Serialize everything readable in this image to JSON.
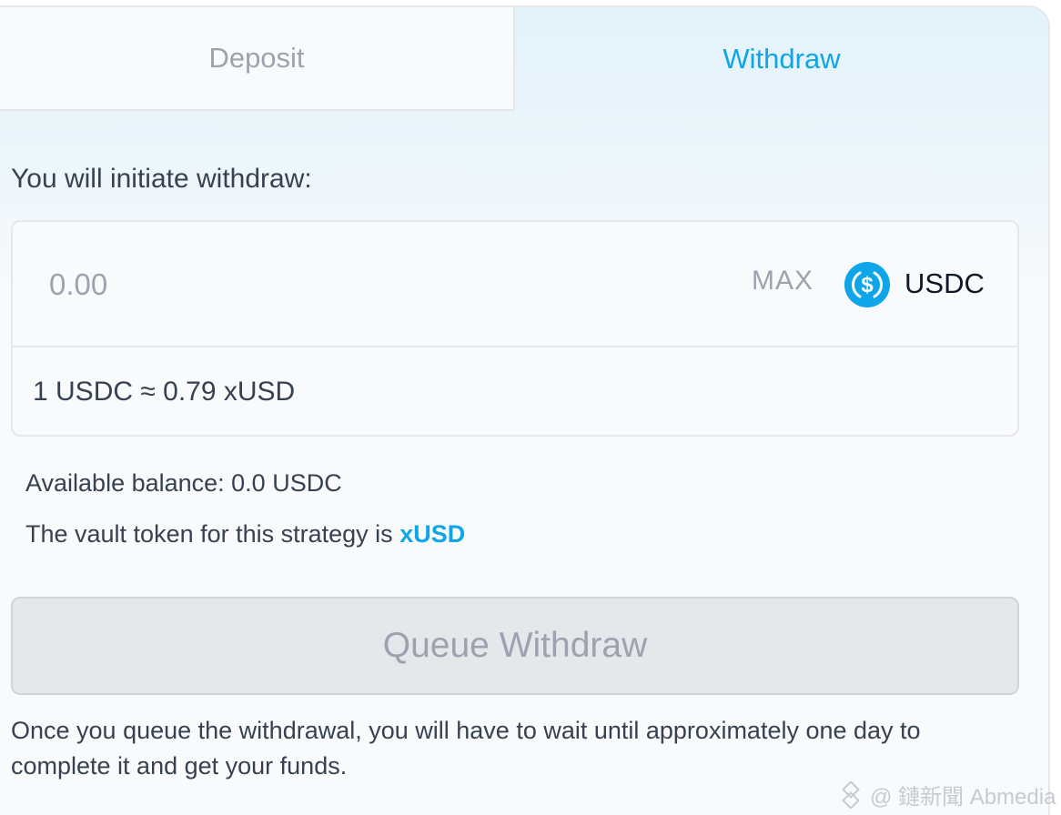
{
  "tabs": [
    {
      "label": "Deposit",
      "active": false
    },
    {
      "label": "Withdraw",
      "active": true
    }
  ],
  "form": {
    "title": "You will initiate withdraw:",
    "amount_placeholder": "0.00",
    "max_label": "MAX",
    "token": {
      "name": "USDC",
      "icon": "usdc-icon",
      "color": "#0ea5e9"
    },
    "rate": "1 USDC ≈ 0.79 xUSD"
  },
  "info": {
    "balance": "Available balance: 0.0 USDC",
    "vault_prefix": "The vault token for this strategy is ",
    "vault_token": "xUSD"
  },
  "actions": {
    "queue_label": "Queue Withdraw"
  },
  "note": "Once you queue the withdrawal, you will have to wait until approximately one day to complete it and get your funds.",
  "watermark": "@ 鏈新聞 Abmedia",
  "colors": {
    "accent": "#0ea5e9",
    "muted": "#9ca3af",
    "text": "#374151",
    "border": "#e5e7eb"
  }
}
